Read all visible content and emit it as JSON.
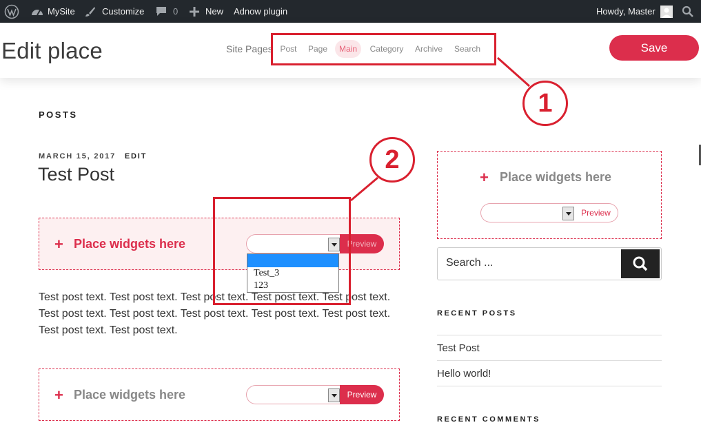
{
  "admin_bar": {
    "site_name": "MySite",
    "customize": "Customize",
    "comment_count": "0",
    "new_label": "New",
    "plugin_label": "Adnow plugin",
    "greeting": "Howdy, Master"
  },
  "header": {
    "title": "Edit place",
    "site_pages_label": "Site Pages",
    "tabs": [
      {
        "label": "Post"
      },
      {
        "label": "Page"
      },
      {
        "label": "Main"
      },
      {
        "label": "Category"
      },
      {
        "label": "Archive"
      },
      {
        "label": "Search"
      }
    ],
    "active_tab": "Main",
    "save_label": "Save"
  },
  "content": {
    "section_heading": "POSTS",
    "post": {
      "date": "MARCH 15, 2017",
      "edit_label": "EDIT",
      "title": "Test Post",
      "body": "Test post text. Test post text. Test post text. Test post text. Test post text. Test post text. Test post text. Test post text. Test post text. Test post text. Test post text. Test post text."
    },
    "widget_zones": [
      {
        "plus": "+",
        "label": "Place widgets here",
        "preview_label": "Preview",
        "selected": ""
      },
      {
        "plus": "+",
        "label": "Place widgets here",
        "preview_label": "Preview",
        "selected": ""
      }
    ],
    "dropdown_options": [
      "",
      "Test_3",
      "123"
    ]
  },
  "sidebar": {
    "widget_zone": {
      "plus": "+",
      "label": "Place widgets here",
      "preview_label": "Preview",
      "selected": ""
    },
    "search_placeholder": "Search ...",
    "recent_posts_heading": "RECENT POSTS",
    "recent_posts": [
      "Test Post",
      "Hello world!"
    ],
    "recent_comments_heading": "RECENT COMMENTS"
  },
  "annotations": [
    {
      "number": "1"
    },
    {
      "number": "2"
    }
  ],
  "colors": {
    "accent": "#dc2e4c",
    "annotation": "#d9202f",
    "admin_bar": "#23282d"
  }
}
